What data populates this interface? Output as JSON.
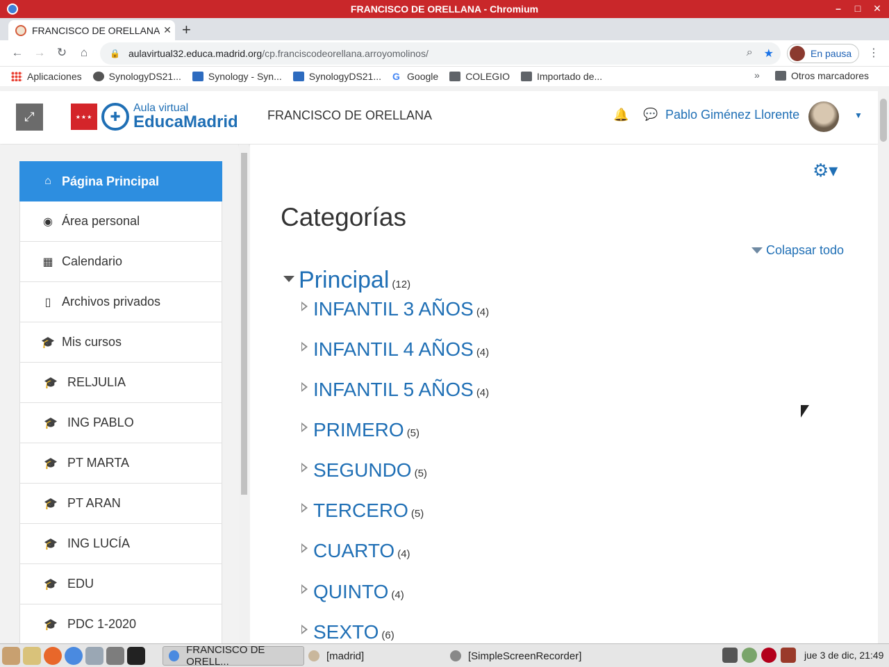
{
  "window": {
    "title": "FRANCISCO DE ORELLANA - Chromium"
  },
  "browser": {
    "tab_title": "FRANCISCO DE ORELLANA",
    "url_host": "aulavirtual32.educa.madrid.org",
    "url_path": "/cp.franciscodeorellana.arroyomolinos/",
    "profile_label": "En pausa",
    "bookmarks": [
      {
        "label": "Aplicaciones",
        "icon": "apps-grid-icon"
      },
      {
        "label": "SynologyDS21...",
        "icon": "globe-icon"
      },
      {
        "label": "Synology - Syn...",
        "icon": "dsm-icon"
      },
      {
        "label": "SynologyDS21...",
        "icon": "dsm-icon"
      },
      {
        "label": "Google",
        "icon": "google-icon"
      },
      {
        "label": "COLEGIO",
        "icon": "folder-icon"
      },
      {
        "label": "Importado de...",
        "icon": "folder-icon"
      }
    ],
    "bookmarks_more": "»",
    "other_bookmarks": "Otros marcadores"
  },
  "site": {
    "logo_line1": "Aula virtual",
    "logo_line2": "EducaMadrid",
    "name": "FRANCISCO DE ORELLANA",
    "user_name": "Pablo Giménez Llorente"
  },
  "nav": {
    "items": [
      {
        "label": "Página Principal",
        "icon": "home-icon"
      },
      {
        "label": "Área personal",
        "icon": "dashboard-icon"
      },
      {
        "label": "Calendario",
        "icon": "calendar-icon"
      },
      {
        "label": "Archivos privados",
        "icon": "file-icon"
      },
      {
        "label": "Mis cursos",
        "icon": "graduation-cap-icon"
      }
    ],
    "courses": [
      "RELJULIA",
      "ING PABLO",
      "PT MARTA",
      "PT ARAN",
      "ING LUCÍA",
      "EDU",
      "PDC 1-2020"
    ]
  },
  "main": {
    "heading": "Categorías",
    "collapse_all": "Colapsar todo",
    "root": {
      "name": "Principal",
      "count": "(12)"
    },
    "categories": [
      {
        "name": "INFANTIL 3 AÑOS",
        "count": "(4)"
      },
      {
        "name": "INFANTIL 4 AÑOS",
        "count": "(4)"
      },
      {
        "name": "INFANTIL 5 AÑOS",
        "count": "(4)"
      },
      {
        "name": "PRIMERO",
        "count": "(5)"
      },
      {
        "name": "SEGUNDO",
        "count": "(5)"
      },
      {
        "name": "TERCERO",
        "count": "(5)"
      },
      {
        "name": "CUARTO",
        "count": "(4)"
      },
      {
        "name": "QUINTO",
        "count": "(4)"
      },
      {
        "name": "SEXTO",
        "count": "(6)"
      }
    ]
  },
  "taskbar": {
    "tasks": [
      "FRANCISCO DE ORELL...",
      "[madrid]",
      "[SimpleScreenRecorder]"
    ],
    "clock": "jue 3 de dic, 21:49"
  },
  "colors": {
    "accent": "#1f6fb5",
    "active_nav": "#2d8ee0",
    "titlebar": "#c9272a"
  }
}
